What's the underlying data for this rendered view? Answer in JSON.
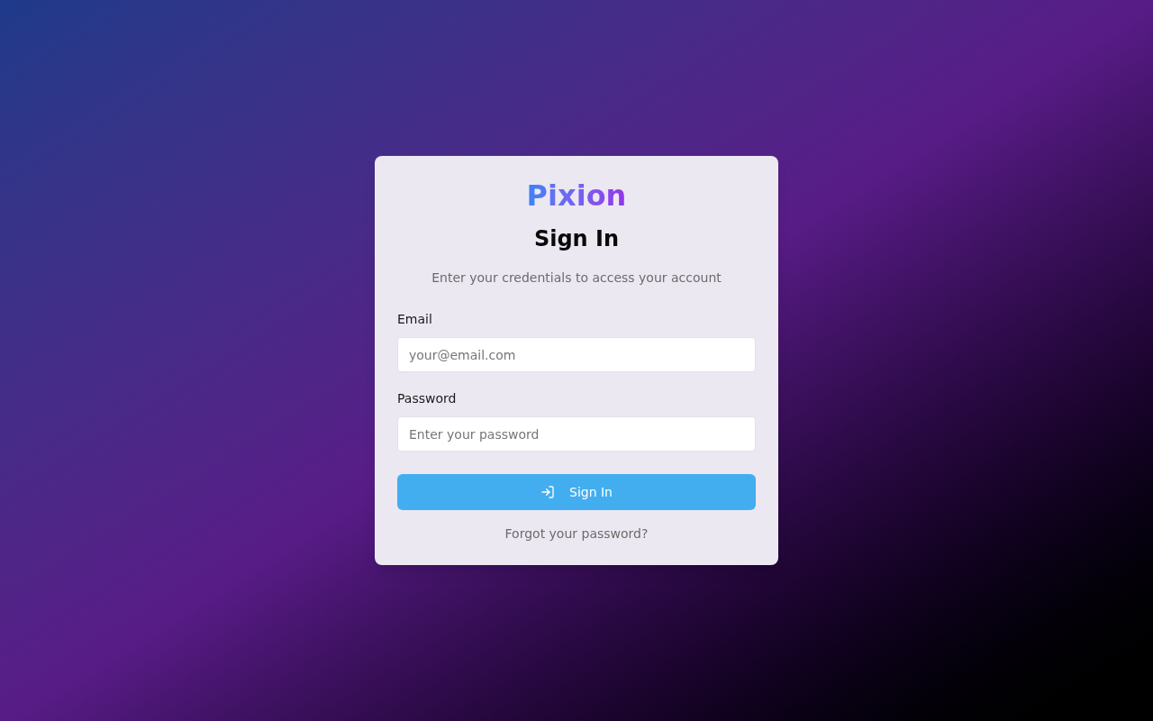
{
  "logo": {
    "text": "Pixion"
  },
  "title": "Sign In",
  "subtitle": "Enter your credentials to access your account",
  "fields": [
    {
      "label": "Email",
      "placeholder": "your@email.com"
    },
    {
      "label": "Password",
      "placeholder": "Enter your password"
    }
  ],
  "submit_button": {
    "label": "Sign In"
  },
  "forgot_link": "Forgot your password?"
}
